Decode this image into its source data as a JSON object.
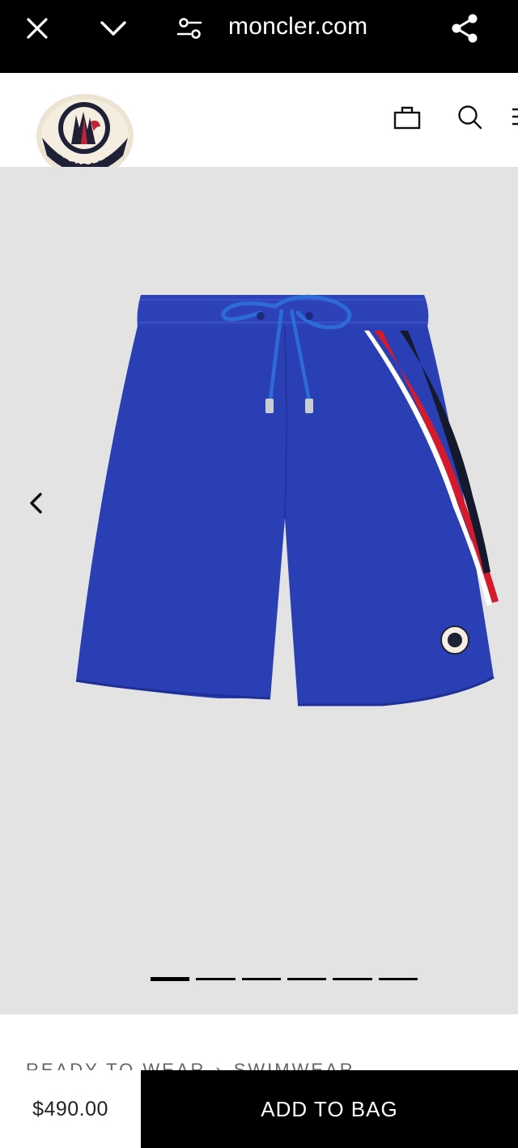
{
  "browser": {
    "url": "moncler.com",
    "icons": [
      "close-icon",
      "chevron-down-icon",
      "site-settings-icon",
      "share-icon"
    ]
  },
  "header": {
    "logo_text": "MONCLER",
    "icons": [
      "shopping-bag-icon",
      "search-icon",
      "menu-icon"
    ]
  },
  "gallery": {
    "slide_count": 6,
    "active_slide": 1,
    "product_colors": {
      "body": "#2a3fb3",
      "stripe_red": "#d31b2c",
      "stripe_navy": "#15192e",
      "background": "#e3e3e3"
    }
  },
  "breadcrumb": {
    "items": [
      "READY TO WEAR",
      "SWIMWEAR"
    ],
    "separator": "›"
  },
  "purchase": {
    "price": "$490.00",
    "add_to_bag_label": "ADD TO BAG"
  }
}
